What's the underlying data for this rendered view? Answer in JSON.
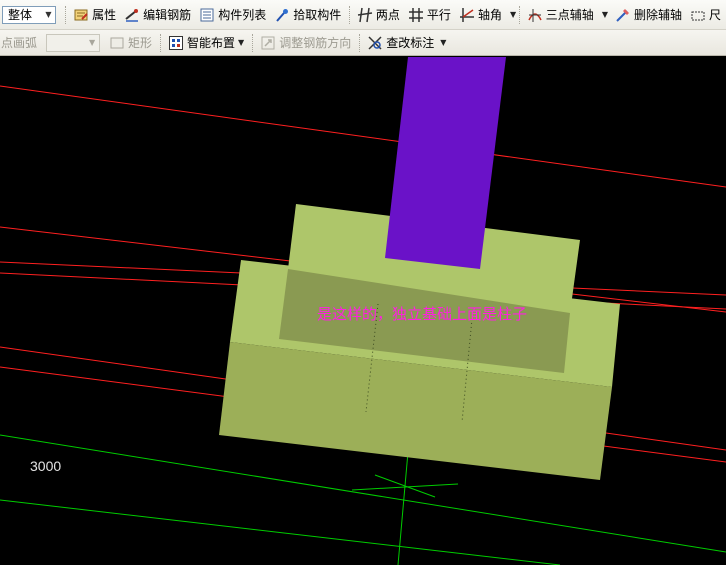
{
  "toolbar1": {
    "scope_select_value": "整体",
    "properties_label": "属性",
    "edit_rebar_label": "编辑钢筋",
    "component_list_label": "构件列表",
    "pick_component_label": "拾取构件",
    "two_point_label": "两点",
    "parallel_label": "平行",
    "axis_angle_label": "轴角",
    "three_point_axis_label": "三点辅轴",
    "delete_axis_label": "删除辅轴",
    "trailing_label": "尺"
  },
  "toolbar2": {
    "arc_label": "点画弧",
    "arc_select_value": "",
    "rectangle_label": "矩形",
    "smart_layout_label": "智能布置",
    "adjust_rebar_direction_label": "调整钢筋方向",
    "check_annotation_label": "查改标注"
  },
  "viewport": {
    "dimension_text": "3000",
    "annotation_text": "是这样的，独立基础上面是柱子"
  },
  "colors": {
    "background": "#000000",
    "axis_line": "#ff2020",
    "grid_line": "#00cc00",
    "foundation_light": "#aec66a",
    "foundation_face": "#9caf58",
    "foundation_inset": "#8a9a52",
    "column": "#6a12c8",
    "annotation": "#ff20e0"
  },
  "icons": {
    "properties": "properties-icon",
    "edit_rebar": "edit-rebar-icon",
    "component_list": "component-list-icon",
    "pick_component": "pick-component-icon",
    "two_point": "two-point-icon",
    "parallel": "parallel-icon",
    "axis_angle": "axis-angle-icon",
    "three_point_axis": "three-point-axis-icon",
    "delete_axis": "delete-axis-icon",
    "smart_layout": "smart-layout-icon",
    "rectangle": "rectangle-icon",
    "adjust_rebar": "adjust-rebar-direction-icon",
    "check_annotation": "check-annotation-icon"
  }
}
